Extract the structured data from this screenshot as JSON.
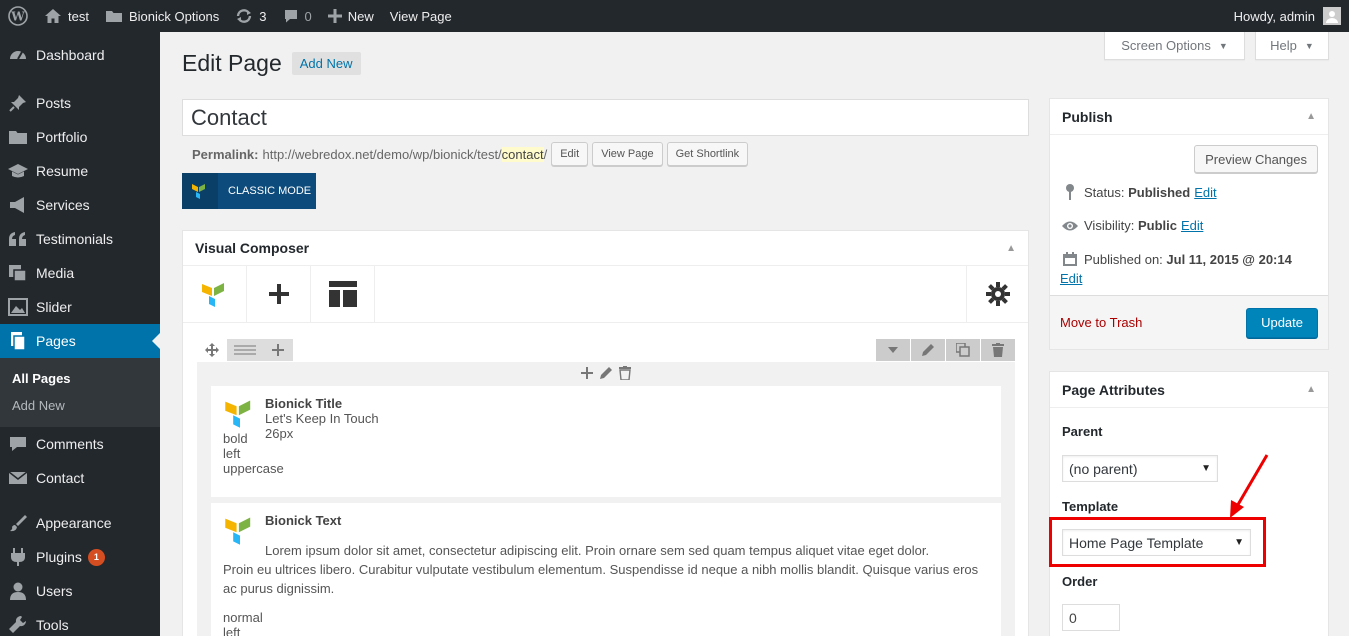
{
  "adminbar": {
    "site_name": "test",
    "options_label": "Bionick Options",
    "updates_count": "3",
    "comments_count": "0",
    "new_label": "New",
    "view_page": "View Page",
    "howdy": "Howdy, admin"
  },
  "sidebar": {
    "items": [
      {
        "label": "Dashboard",
        "icon": "dashboard-icon"
      },
      {
        "label": "Posts",
        "icon": "pin-icon"
      },
      {
        "label": "Portfolio",
        "icon": "folder-icon"
      },
      {
        "label": "Resume",
        "icon": "graduation-cap-icon"
      },
      {
        "label": "Services",
        "icon": "megaphone-icon"
      },
      {
        "label": "Testimonials",
        "icon": "quote-icon"
      },
      {
        "label": "Media",
        "icon": "media-icon"
      },
      {
        "label": "Slider",
        "icon": "slider-icon"
      },
      {
        "label": "Pages",
        "icon": "pages-icon"
      },
      {
        "label": "Comments",
        "icon": "comment-icon"
      },
      {
        "label": "Contact",
        "icon": "envelope-icon"
      },
      {
        "label": "Appearance",
        "icon": "brush-icon"
      },
      {
        "label": "Plugins",
        "icon": "plugin-icon",
        "badge": "1"
      },
      {
        "label": "Users",
        "icon": "user-icon"
      },
      {
        "label": "Tools",
        "icon": "wrench-icon"
      }
    ],
    "submenu": [
      "All Pages",
      "Add New"
    ]
  },
  "screen_meta": {
    "screen_options": "Screen Options",
    "help": "Help"
  },
  "header": {
    "title": "Edit Page",
    "add_new": "Add New"
  },
  "post": {
    "title": "Contact",
    "permalink_label": "Permalink:",
    "permalink_base": "http://webredox.net/demo/wp/bionick/test/",
    "slug": "contact",
    "permalink_tail": "/",
    "edit": "Edit",
    "view_page": "View Page",
    "get_shortlink": "Get Shortlink",
    "classic_mode": "Classic Mode"
  },
  "composer": {
    "title": "Visual Composer",
    "elements": [
      {
        "name": "Bionick Title",
        "lines": [
          "Let's Keep In Touch",
          "26px"
        ],
        "extra": [
          "bold",
          "left",
          "uppercase"
        ]
      },
      {
        "name": "Bionick Text",
        "para_first": "Lorem ipsum dolor sit amet, consectetur adipiscing elit. Proin ornare sem sed quam tempus aliquet vitae eget dolor.",
        "para_rest": "Proin eu ultrices libero. Curabitur vulputate vestibulum elementum. Suspendisse id neque a nibh mollis blandit. Quisque varius eros ac purus dignissim.",
        "extra": [
          "normal",
          "left"
        ]
      }
    ]
  },
  "publish": {
    "title": "Publish",
    "preview": "Preview Changes",
    "status_label": "Status:",
    "status_value": "Published",
    "visibility_label": "Visibility:",
    "visibility_value": "Public",
    "published_label": "Published on:",
    "published_value": "Jul 11, 2015 @ 20:14",
    "edit": "Edit",
    "trash": "Move to Trash",
    "update": "Update"
  },
  "page_attributes": {
    "title": "Page Attributes",
    "parent_label": "Parent",
    "parent_value": "(no parent)",
    "template_label": "Template",
    "template_value": "Home Page Template",
    "order_label": "Order",
    "order_value": "0"
  },
  "colors": {
    "admin_bg": "#23282d",
    "accent": "#0073aa",
    "primary_button": "#0085ba",
    "highlight": "#e00000"
  }
}
